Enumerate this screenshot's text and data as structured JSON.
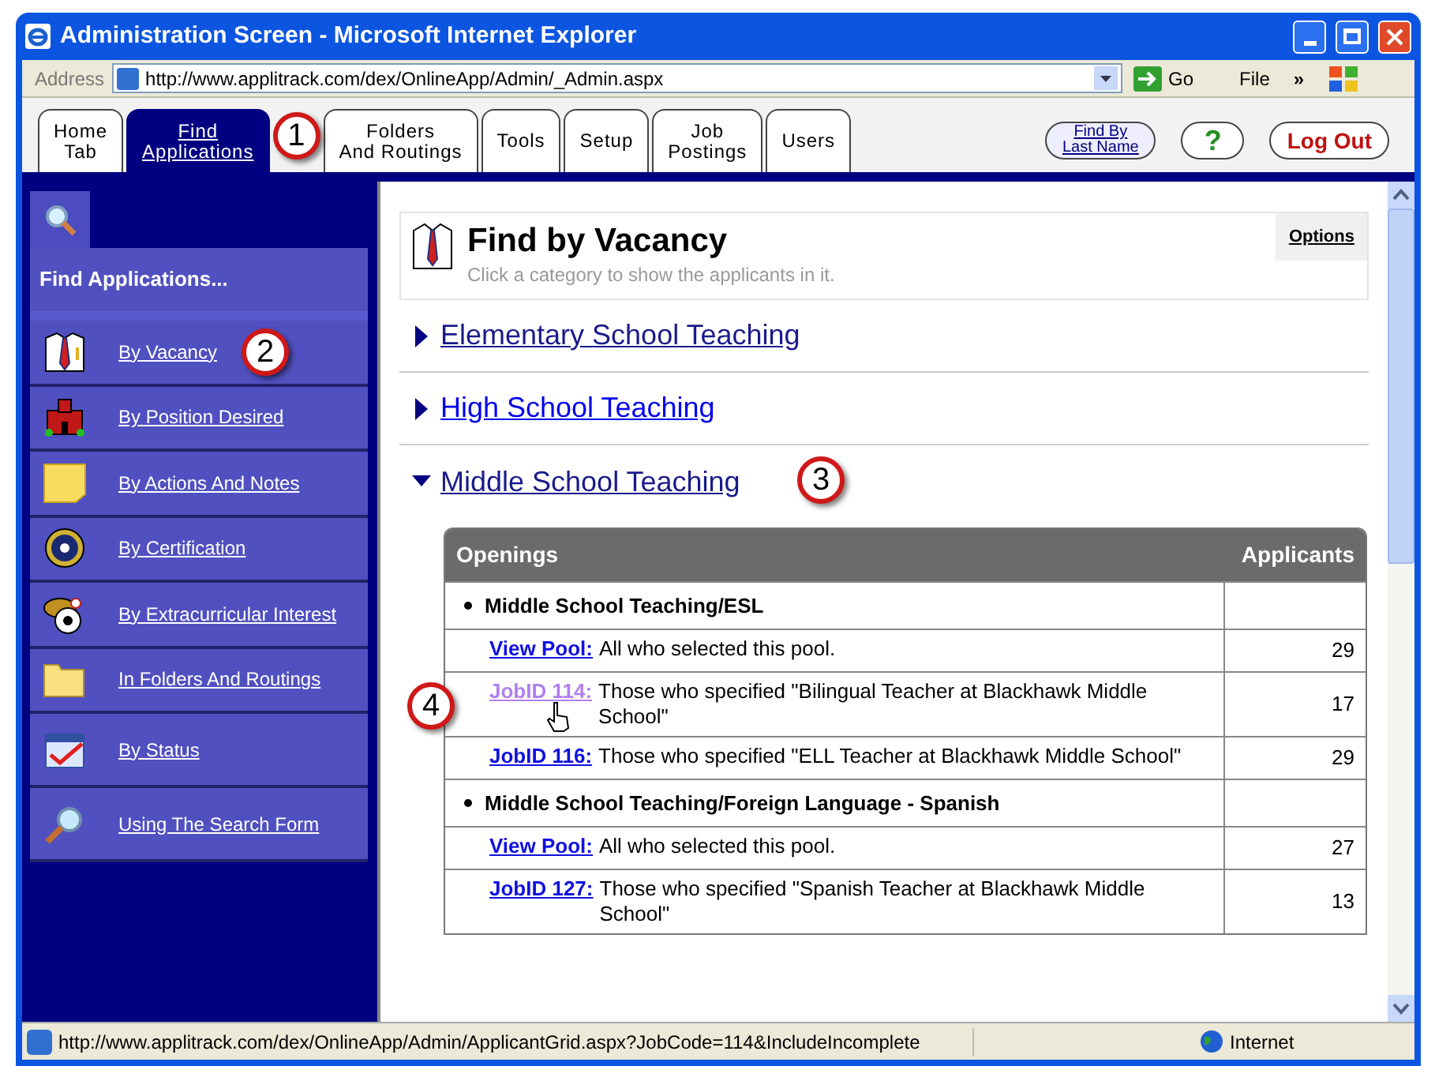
{
  "window": {
    "title": "Administration Screen - Microsoft Internet Explorer"
  },
  "address_bar": {
    "label": "Address",
    "value": "http://www.applitrack.com/dex/OnlineApp/Admin/_Admin.aspx",
    "go": "Go",
    "menu": "File",
    "more": "»"
  },
  "tabs": [
    {
      "label": "Home\nTab",
      "selected": false
    },
    {
      "label": "Find\nApplications",
      "selected": true,
      "callout": "1"
    },
    {
      "label": "Folders\nAnd Routings",
      "selected": false
    },
    {
      "label": "Tools",
      "selected": false
    },
    {
      "label": "Setup",
      "selected": false
    },
    {
      "label": "Job\nPostings",
      "selected": false
    },
    {
      "label": "Users",
      "selected": false
    }
  ],
  "toolbar_buttons": [
    {
      "kind": "text",
      "label": "Find By\nLast Name"
    },
    {
      "kind": "help",
      "label": "?"
    },
    {
      "kind": "logout",
      "label": "Log Out"
    }
  ],
  "sidebar": {
    "title": "Find Applications...",
    "items": [
      {
        "label": "By Vacancy",
        "callout": "2"
      },
      {
        "label": "By Position Desired"
      },
      {
        "label": "By Actions And Notes"
      },
      {
        "label": "By Certification"
      },
      {
        "label": "By Extracurricular Interest"
      },
      {
        "label": "In Folders And Routings"
      },
      {
        "label": "By Status"
      },
      {
        "label": "Using The Search Form"
      }
    ]
  },
  "header": {
    "title": "Find by Vacancy",
    "subtitle": "Click a category to show the applicants in it.",
    "options": "Options"
  },
  "categories": [
    {
      "label": "Elementary School Teaching",
      "expanded": false,
      "visited": true
    },
    {
      "label": "High School Teaching",
      "expanded": false,
      "visited": false
    },
    {
      "label": "Middle School Teaching",
      "expanded": true,
      "visited": true,
      "callout": "3"
    }
  ],
  "table": {
    "columns": [
      "Openings",
      "Applicants"
    ],
    "rows": [
      {
        "kind": "group",
        "title": "Middle School Teaching/ESL"
      },
      {
        "kind": "link",
        "link": "View Pool:",
        "text": "All who selected this pool.",
        "count": "29",
        "visited": false,
        "hovered": false
      },
      {
        "kind": "link",
        "link": "JobID 114:",
        "text": "Those who specified \"Bilingual Teacher at Blackhawk Middle School\"",
        "count": "17",
        "visited": true,
        "hovered": true,
        "callout": "4"
      },
      {
        "kind": "link",
        "link": "JobID 116:",
        "text": "Those who specified \"ELL Teacher at Blackhawk Middle School\"",
        "count": "29",
        "visited": false,
        "hovered": false
      },
      {
        "kind": "group",
        "title": "Middle School Teaching/Foreign Language - Spanish"
      },
      {
        "kind": "link",
        "link": "View Pool:",
        "text": "All who selected this pool.",
        "count": "27",
        "visited": false,
        "hovered": false
      },
      {
        "kind": "link",
        "link": "JobID 127:",
        "text": "Those who specified \"Spanish Teacher at Blackhawk Middle School\"",
        "count": "13",
        "visited": false,
        "hovered": false
      }
    ]
  },
  "status_bar": {
    "url": "http://www.applitrack.com/dex/OnlineApp/Admin/ApplicantGrid.aspx?JobCode=114&IncludeIncomplete",
    "zone": "Internet"
  }
}
